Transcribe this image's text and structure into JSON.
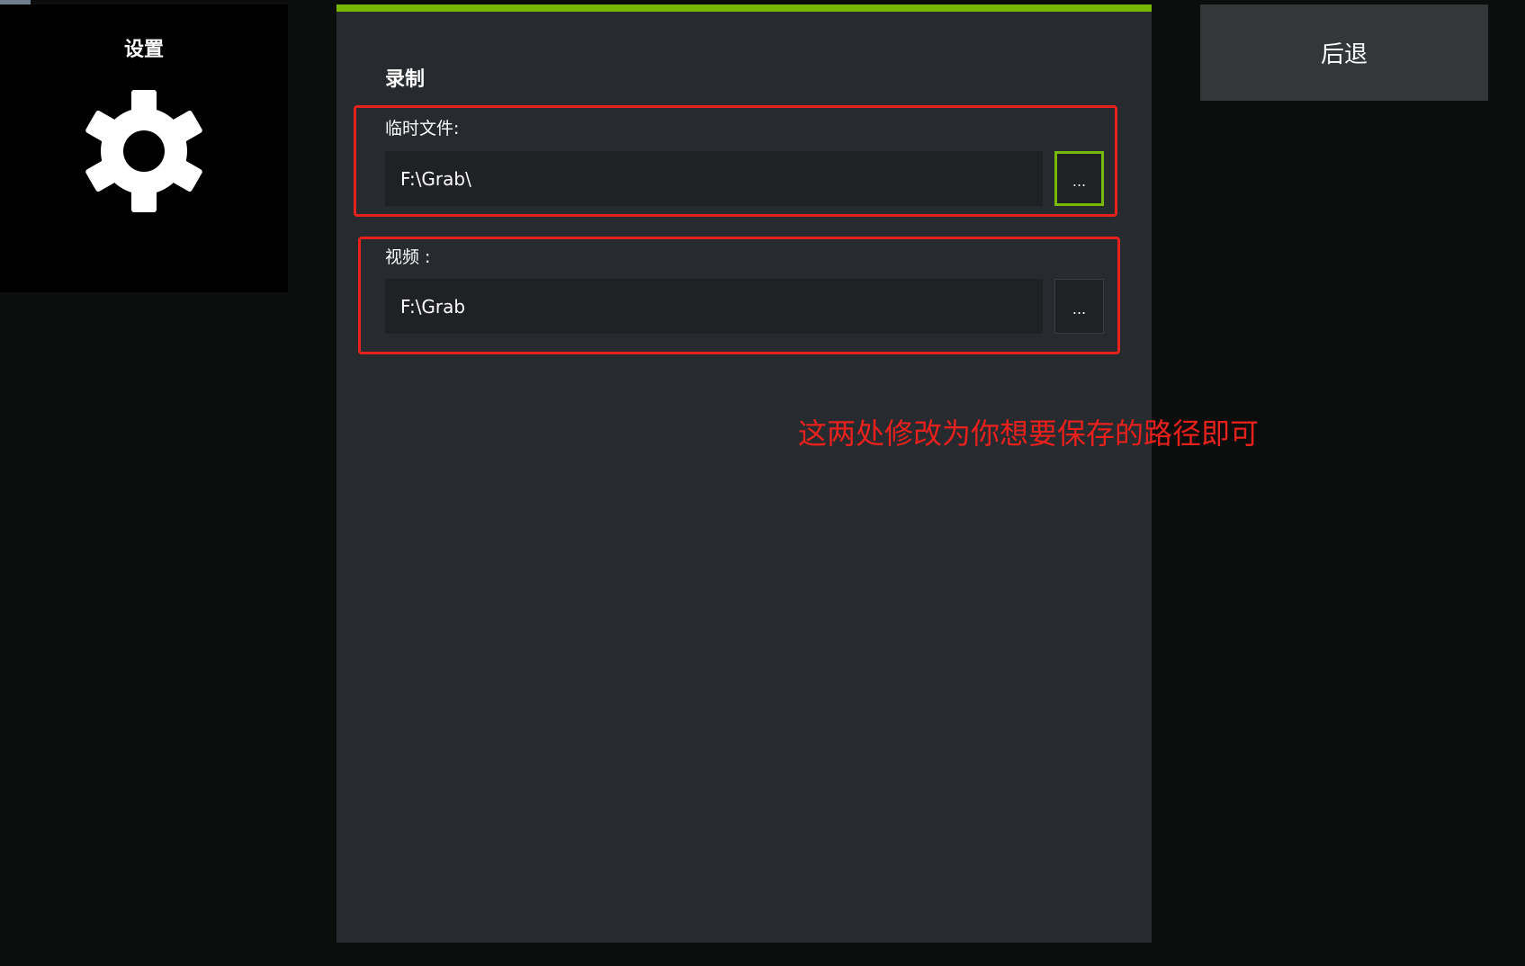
{
  "sidebar": {
    "title": "设置",
    "icon": "gear-icon"
  },
  "panel": {
    "section_title": "录制",
    "temp_files": {
      "label": "临时文件:",
      "value": "F:\\Grab\\",
      "browse_label": "..."
    },
    "video": {
      "label": "视频 :",
      "value": "F:\\Grab",
      "browse_label": "..."
    }
  },
  "back_button": {
    "label": "后退"
  },
  "annotation": {
    "text": "这两处修改为你想要保存的路径即可"
  },
  "colors": {
    "accent": "#76b900",
    "highlight": "#e8211d",
    "panel_bg": "#272a2e",
    "page_bg": "#0c0d0d"
  }
}
